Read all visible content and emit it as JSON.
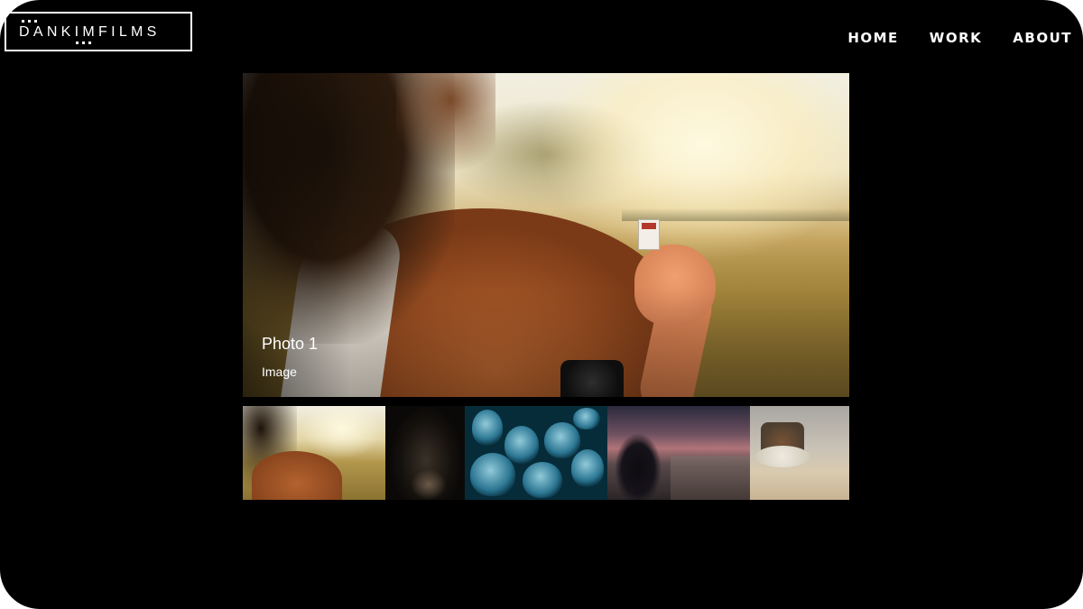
{
  "brand": {
    "logo_text": "DANKIMFILMS"
  },
  "nav": {
    "items": [
      {
        "label": "HOME"
      },
      {
        "label": "WORK"
      },
      {
        "label": "ABOUT"
      }
    ]
  },
  "hero": {
    "title": "Photo 1",
    "subtitle": "Image"
  },
  "thumbnails": [
    {
      "name": "woman-sunlight"
    },
    {
      "name": "dark-portrait"
    },
    {
      "name": "jellyfish"
    },
    {
      "name": "man-city-view"
    },
    {
      "name": "glass-jar"
    }
  ],
  "colors": {
    "background": "#000000",
    "text": "#ffffff"
  }
}
